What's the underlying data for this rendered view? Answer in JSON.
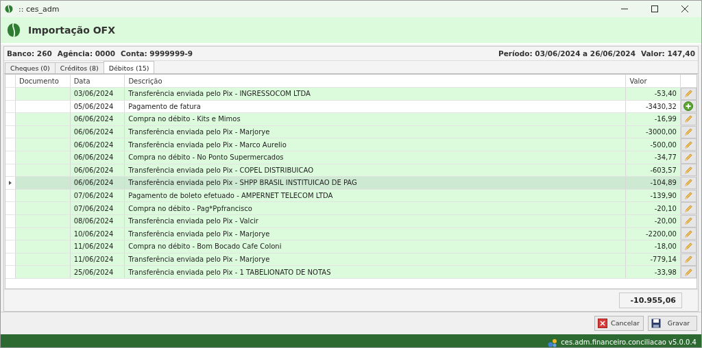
{
  "window": {
    "title": ":: ces_adm"
  },
  "header": {
    "title": "Importação OFX"
  },
  "info": {
    "bank": "Banco: 260",
    "agency": "Agência: 0000",
    "account": "Conta: 9999999-9",
    "period": "Período: 03/06/2024 a 26/06/2024",
    "value": "Valor: 147,40"
  },
  "tabs": [
    {
      "label": "Cheques (0)",
      "selected": false
    },
    {
      "label": "Créditos (8)",
      "selected": false
    },
    {
      "label": "Débitos (15)",
      "selected": true
    }
  ],
  "table": {
    "columns": [
      "Documento",
      "Data",
      "Descrição",
      "Valor"
    ],
    "rows": [
      {
        "date": "03/06/2024",
        "description": "Transferência enviada pelo Pix - INGRESSOCOM LTDA",
        "value": "-53,40",
        "kind": "edit",
        "selected": false
      },
      {
        "date": "05/06/2024",
        "description": "Pagamento de fatura",
        "value": "-3430,32",
        "kind": "add",
        "selected": false
      },
      {
        "date": "06/06/2024",
        "description": "Compra no débito - Kits e Mimos",
        "value": "-16,99",
        "kind": "edit",
        "selected": false
      },
      {
        "date": "06/06/2024",
        "description": "Transferência enviada pelo Pix - Marjorye",
        "value": "-3000,00",
        "kind": "edit",
        "selected": false
      },
      {
        "date": "06/06/2024",
        "description": "Transferência enviada pelo Pix - Marco Aurelio",
        "value": "-500,00",
        "kind": "edit",
        "selected": false
      },
      {
        "date": "06/06/2024",
        "description": "Compra no débito - No Ponto Supermercados",
        "value": "-34,77",
        "kind": "edit",
        "selected": false
      },
      {
        "date": "06/06/2024",
        "description": "Transferência enviada pelo Pix - COPEL DISTRIBUICAO",
        "value": "-603,57",
        "kind": "edit",
        "selected": false
      },
      {
        "date": "06/06/2024",
        "description": "Transferência enviada pelo Pix - SHPP BRASIL INSTITUICAO DE PAG",
        "value": "-104,89",
        "kind": "edit",
        "selected": true
      },
      {
        "date": "07/06/2024",
        "description": "Pagamento de boleto efetuado - AMPERNET TELECOM LTDA",
        "value": "-139,90",
        "kind": "edit",
        "selected": false
      },
      {
        "date": "07/06/2024",
        "description": "Compra no débito - Pag*Ppfrancisco",
        "value": "-20,10",
        "kind": "edit",
        "selected": false
      },
      {
        "date": "08/06/2024",
        "description": "Transferência enviada pelo Pix - Valcir",
        "value": "-20,00",
        "kind": "edit",
        "selected": false
      },
      {
        "date": "10/06/2024",
        "description": "Transferência enviada pelo Pix - Marjorye",
        "value": "-2200,00",
        "kind": "edit",
        "selected": false
      },
      {
        "date": "11/06/2024",
        "description": "Compra no débito - Bom Bocado Cafe Coloni",
        "value": "-18,00",
        "kind": "edit",
        "selected": false
      },
      {
        "date": "11/06/2024",
        "description": "Transferência enviada pelo Pix - Marjorye",
        "value": "-779,14",
        "kind": "edit",
        "selected": false
      },
      {
        "date": "25/06/2024",
        "description": "Transferência enviada pelo Pix - 1 TABELIONATO DE NOTAS",
        "value": "-33,98",
        "kind": "edit",
        "selected": false
      }
    ],
    "total": "-10.955,06"
  },
  "buttons": [
    "Cancelar",
    "Gravar"
  ],
  "status_bar": {
    "text": "ces.adm.financeiro.conciliacao v5.0.0.4"
  }
}
